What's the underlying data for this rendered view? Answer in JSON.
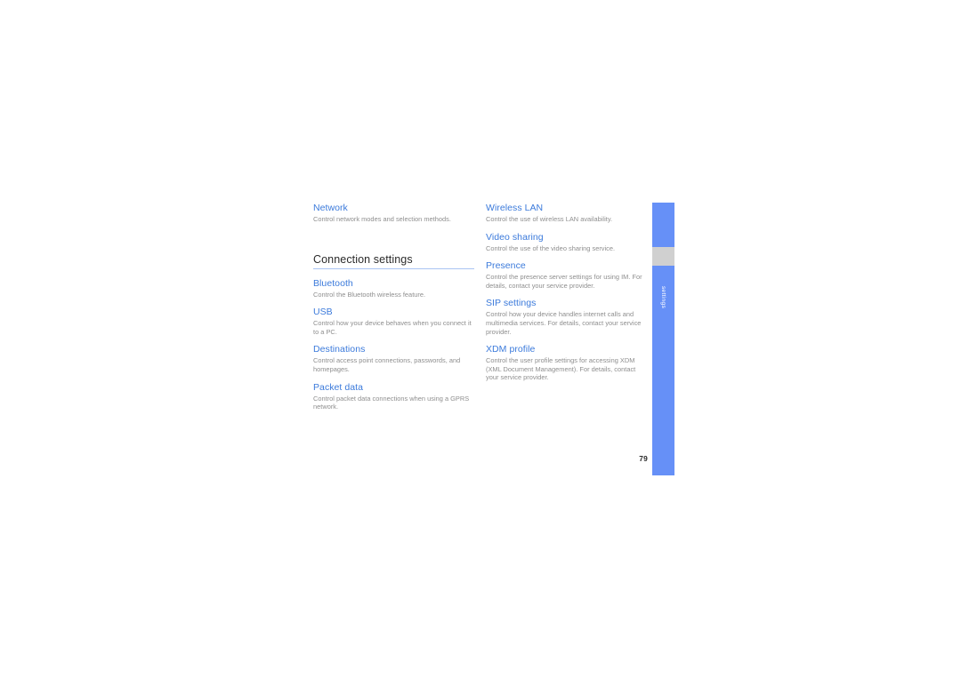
{
  "document": {
    "page_number": "79",
    "side_tab_label": "settings",
    "colors": {
      "accent_blue": "#3b7adb",
      "tab_blue": "#6690f7",
      "tab_gap_gray": "#d0d0d0",
      "body_gray": "#8e8e8e",
      "rule_blue": "#a9c4f2",
      "heading_dark": "#2b2b2b",
      "page_background": "#ffffff"
    }
  },
  "columns": {
    "left": {
      "blocks": [
        {
          "type": "entry",
          "title": "Network",
          "desc": "Control network modes and selection methods."
        },
        {
          "type": "section-header",
          "title": "Connection settings"
        },
        {
          "type": "entry",
          "title": "Bluetooth",
          "desc": "Control the Bluetooth wireless feature."
        },
        {
          "type": "entry",
          "title": "USB",
          "desc": "Control how your device behaves when you connect it to a PC."
        },
        {
          "type": "entry",
          "title": "Destinations",
          "desc": "Control access point connections, passwords, and homepages."
        },
        {
          "type": "entry",
          "title": "Packet data",
          "desc": "Control packet data connections when using a GPRS network."
        }
      ]
    },
    "right": {
      "blocks": [
        {
          "type": "entry",
          "title": "Wireless LAN",
          "desc": "Control the use of wireless LAN availability."
        },
        {
          "type": "entry",
          "title": "Video sharing",
          "desc": "Control the use of the video sharing service."
        },
        {
          "type": "entry",
          "title": "Presence",
          "desc": "Control the presence server settings for using IM. For details, contact your service provider."
        },
        {
          "type": "entry",
          "title": "SIP settings",
          "desc": "Control how your device handles internet calls and multimedia services. For details, contact your service provider."
        },
        {
          "type": "entry",
          "title": "XDM profile",
          "desc": "Control the user profile settings for accessing XDM (XML Document Management). For details, contact your service provider."
        }
      ]
    }
  }
}
